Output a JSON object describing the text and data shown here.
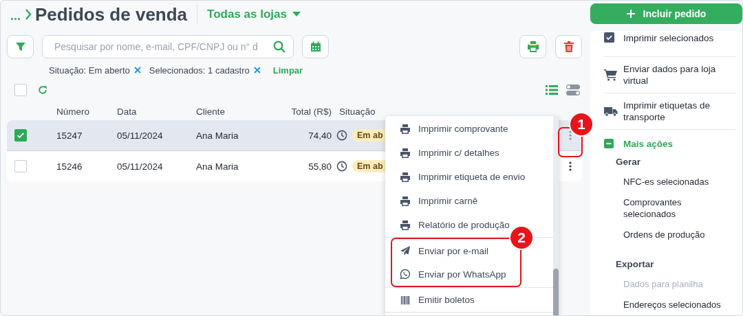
{
  "header": {
    "breadcrumb": "...",
    "title": "Pedidos de venda",
    "store_selector": "Todas as lojas"
  },
  "search": {
    "placeholder": "Pesquisar por nome, e-mail, CPF/CNPJ ou n° d"
  },
  "filters": [
    {
      "label": "Situação: Em aberto"
    },
    {
      "label": "Selecionados: 1 cadastro"
    }
  ],
  "clear_filters": "Limpar",
  "select_all": {
    "checked": false
  },
  "table": {
    "columns": [
      "Número",
      "Data",
      "Cliente",
      "Total (R$)",
      "Situação"
    ],
    "rows": [
      {
        "selected": true,
        "number": "15247",
        "date": "05/11/2024",
        "client": "Ana Maria",
        "total": "74,40",
        "status": "Em ab"
      },
      {
        "selected": false,
        "number": "15246",
        "date": "05/11/2024",
        "client": "Ana Maria",
        "total": "55,80",
        "status": "Em ab"
      }
    ]
  },
  "row_menu": {
    "items": [
      {
        "kind": "print",
        "label": "Imprimir comprovante"
      },
      {
        "kind": "print",
        "label": "Imprimir c/ detalhes"
      },
      {
        "kind": "print",
        "label": "Imprimir etiqueta de envio"
      },
      {
        "kind": "print",
        "label": "Imprimir carnê"
      },
      {
        "kind": "print",
        "label": "Relatório de produção"
      },
      {
        "kind": "email",
        "label": "Enviar por e-mail",
        "highlighted": true
      },
      {
        "kind": "whatsapp",
        "label": "Enviar por WhatsApp",
        "highlighted": true
      },
      {
        "kind": "barcode",
        "label": "Emitir boletos"
      }
    ]
  },
  "actions_menu": {
    "button": "Incluir pedido",
    "items": [
      {
        "kind": "checkbox",
        "label": "Imprimir selecionados"
      },
      {
        "kind": "cart",
        "label": "Enviar dados para loja virtual"
      },
      {
        "kind": "truck",
        "label": "Imprimir etiquetas de transporte"
      }
    ],
    "more_actions": {
      "label": "Mais ações",
      "expanded": true,
      "groups": [
        {
          "title": "Gerar",
          "items": [
            {
              "label": "NFC-es selecionadas",
              "disabled": false
            },
            {
              "label": "Comprovantes selecionados",
              "disabled": false
            },
            {
              "label": "Ordens de produção",
              "disabled": false
            }
          ]
        },
        {
          "title": "Exportar",
          "items": [
            {
              "label": "Dados para planilha",
              "disabled": true
            },
            {
              "label": "Endereços selecionados",
              "disabled": false
            }
          ]
        }
      ]
    }
  },
  "annotations": [
    {
      "label": "1"
    },
    {
      "label": "2"
    }
  ]
}
